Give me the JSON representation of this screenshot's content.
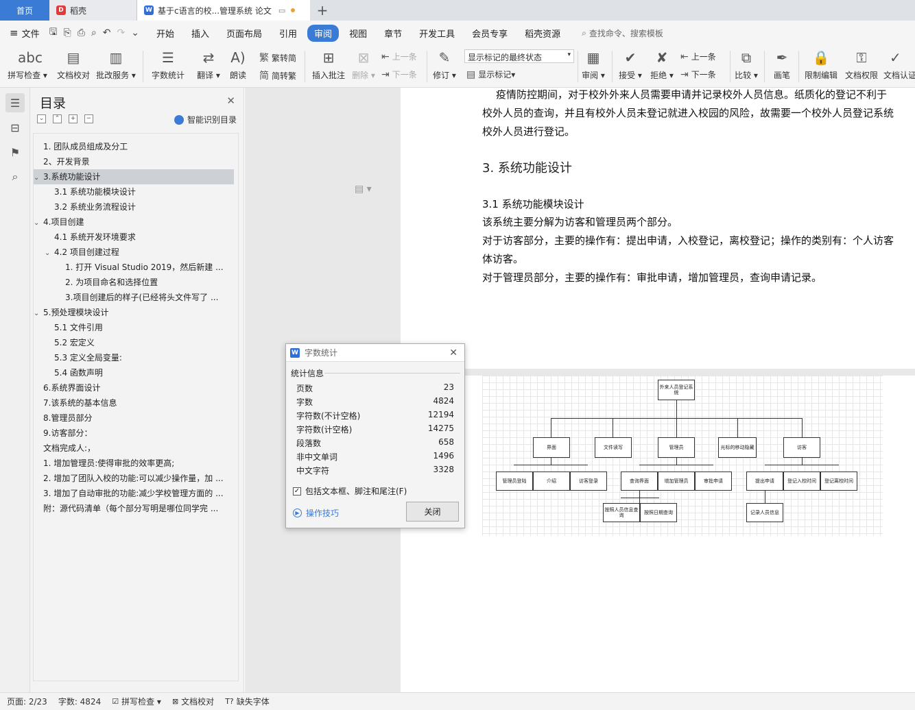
{
  "tabs": {
    "home": "首页",
    "daoke": "稻壳",
    "doc": "基于c语言的校...管理系统 论文"
  },
  "menu": {
    "file": "文件",
    "items": [
      "开始",
      "插入",
      "页面布局",
      "引用",
      "审阅",
      "视图",
      "章节",
      "开发工具",
      "会员专享",
      "稻壳资源"
    ],
    "active": "审阅",
    "search": "查找命令、搜索模板"
  },
  "ribbon": {
    "spell": "拼写检查",
    "proof": "文档校对",
    "annot_service": "批改服务",
    "word_count": "字数统计",
    "translate": "翻译",
    "read": "朗读",
    "to_trad": "繁转简",
    "to_simp": "简转繁",
    "insert_comment": "插入批注",
    "delete": "删除",
    "prev": "上一条",
    "next": "下一条",
    "revise": "修订",
    "markup_state": "显示标记的最终状态",
    "show_markup": "显示标记",
    "review": "审阅",
    "accept": "接受",
    "reject": "拒绝",
    "prev2": "上一条",
    "next2": "下一条",
    "compare": "比较",
    "pen": "画笔",
    "restrict": "限制编辑",
    "perm": "文档权限",
    "auth": "文档认证"
  },
  "nav": {
    "title": "目录",
    "smart": "智能识别目录",
    "items": [
      {
        "text": "1. 团队成员组成及分工",
        "level": 1,
        "caret": ""
      },
      {
        "text": "2、开发背景",
        "level": 1,
        "caret": ""
      },
      {
        "text": "3.系统功能设计",
        "level": 1,
        "caret": "v",
        "selected": true
      },
      {
        "text": "3.1 系统功能模块设计",
        "level": 2,
        "caret": ""
      },
      {
        "text": "3.2  系统业务流程设计",
        "level": 2,
        "caret": ""
      },
      {
        "text": "4.项目创建",
        "level": 1,
        "caret": "v"
      },
      {
        "text": "4.1 系统开发环境要求",
        "level": 2,
        "caret": ""
      },
      {
        "text": "4.2  项目创建过程",
        "level": 2,
        "caret": "v"
      },
      {
        "text": "1. 打开 Visual Studio 2019，然后新建 ...",
        "level": 3,
        "caret": ""
      },
      {
        "text": "2. 为项目命名和选择位置",
        "level": 3,
        "caret": ""
      },
      {
        "text": "3.项目创建后的样子(已经将头文件写了 ...",
        "level": 3,
        "caret": ""
      },
      {
        "text": "5.预处理模块设计",
        "level": 1,
        "caret": "v"
      },
      {
        "text": "5.1  文件引用",
        "level": 2,
        "caret": ""
      },
      {
        "text": "5.2 宏定义",
        "level": 2,
        "caret": ""
      },
      {
        "text": "5.3 定义全局变量:",
        "level": 2,
        "caret": ""
      },
      {
        "text": "5.4 函数声明",
        "level": 2,
        "caret": ""
      },
      {
        "text": "6.系统界面设计",
        "level": 1,
        "caret": ""
      },
      {
        "text": "7.该系统的基本信息",
        "level": 1,
        "caret": ""
      },
      {
        "text": "8.管理员部分",
        "level": 1,
        "caret": ""
      },
      {
        "text": "9.访客部分：",
        "level": 1,
        "caret": ""
      },
      {
        "text": "文档完成人:，",
        "level": 1,
        "caret": ""
      },
      {
        "text": "1.    增加管理员:使得审批的效率更高;",
        "level": 1,
        "caret": ""
      },
      {
        "text": "2. 增加了团队入校的功能:可以减少操作量，加 ...",
        "level": 1,
        "caret": ""
      },
      {
        "text": "3. 增加了自动审批的功能:减少学校管理方面的 ...",
        "level": 1,
        "caret": ""
      },
      {
        "text": "附：源代码清单（每个部分写明是哪位同学完 ...",
        "level": 1,
        "caret": ""
      }
    ]
  },
  "document": {
    "line1": "疫情防控期间，对于校外外来人员需要申请并记录校外人员信息。纸质化的登记不利于",
    "line2": "校外人员的查询，并且有校外人员未登记就进入校园的风险，故需要一个校外人员登记系统",
    "line3": "校外人员进行登记。",
    "heading": "3. 系统功能设计",
    "subheading": "3.1 系统功能模块设计",
    "para1": "该系统主要分解为访客和管理员两个部分。",
    "para2a": "对于访客部分，主要的操作有：提出申请，入校登记，离校登记；操作的类别有：个人访客",
    "para2b": "体访客。",
    "para3": "对于管理员部分，主要的操作有：审批申请，增加管理员，查询申请记录。",
    "flow": {
      "root": "外来人员登记系统",
      "level1": [
        "界面",
        "文件读写",
        "管理员",
        "光标的移动隐藏",
        "访客"
      ],
      "ui_children": [
        "管理员登陆",
        "介绍",
        "访客登录"
      ],
      "admin_children": [
        "查询界面",
        "增加管理员",
        "审批申请"
      ],
      "visitor_children": [
        "提出申请",
        "登记入校时间",
        "登记离校时间"
      ],
      "query_children": [
        "按照人员信息查询",
        "按照日期查询"
      ],
      "apply_children": [
        "记录人员信息"
      ]
    }
  },
  "dialog": {
    "title": "字数统计",
    "section": "统计信息",
    "stats": [
      {
        "label": "页数",
        "value": "23"
      },
      {
        "label": "字数",
        "value": "4824"
      },
      {
        "label": "字符数(不计空格)",
        "value": "12194"
      },
      {
        "label": "字符数(计空格)",
        "value": "14275"
      },
      {
        "label": "段落数",
        "value": "658"
      },
      {
        "label": "非中文单词",
        "value": "1496"
      },
      {
        "label": "中文字符",
        "value": "3328"
      }
    ],
    "include": "包括文本框、脚注和尾注(F)",
    "tips": "操作技巧",
    "close": "关闭"
  },
  "status": {
    "page": "页面: 2/23",
    "words": "字数: 4824",
    "spell": "拼写检查",
    "proof": "文档校对",
    "font": "缺失字体"
  }
}
